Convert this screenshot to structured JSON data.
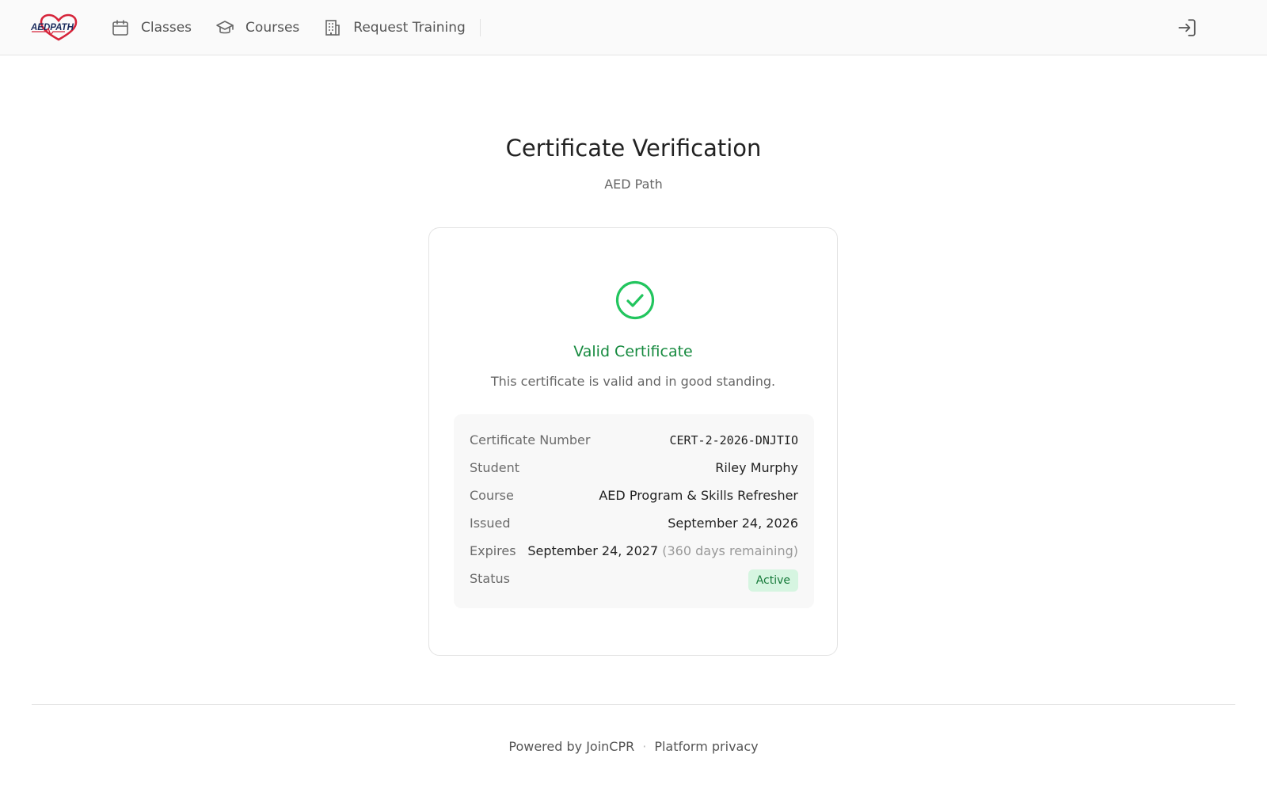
{
  "header": {
    "logo_text": "AEDPATH",
    "nav": [
      {
        "label": "Classes",
        "icon": "calendar-icon"
      },
      {
        "label": "Courses",
        "icon": "graduation-cap-icon"
      },
      {
        "label": "Request Training",
        "icon": "building-icon"
      }
    ],
    "signin_icon": "sign-in-icon"
  },
  "page": {
    "title": "Certificate Verification",
    "subtitle": "AED Path"
  },
  "card": {
    "status_icon": "check-circle-icon",
    "valid_title": "Valid Certificate",
    "valid_desc": "This certificate is valid and in good standing.",
    "details": {
      "certificate_number_label": "Certificate Number",
      "certificate_number": "CERT-2-2026-DNJTIO",
      "student_label": "Student",
      "student": "Riley Murphy",
      "course_label": "Course",
      "course": "AED Program & Skills Refresher",
      "issued_label": "Issued",
      "issued": "September 24, 2026",
      "expires_label": "Expires",
      "expires": "September 24, 2027",
      "expires_remaining": "(360 days remaining)",
      "status_label": "Status",
      "status": "Active"
    }
  },
  "footer": {
    "powered_by": "Powered by JoinCPR",
    "separator": "·",
    "privacy": "Platform privacy"
  },
  "colors": {
    "accent_green": "#22c55e",
    "valid_text": "#168a3f",
    "badge_bg": "#d6f5e1",
    "logo_red": "#d6243a",
    "logo_navy": "#1a2a5c"
  }
}
